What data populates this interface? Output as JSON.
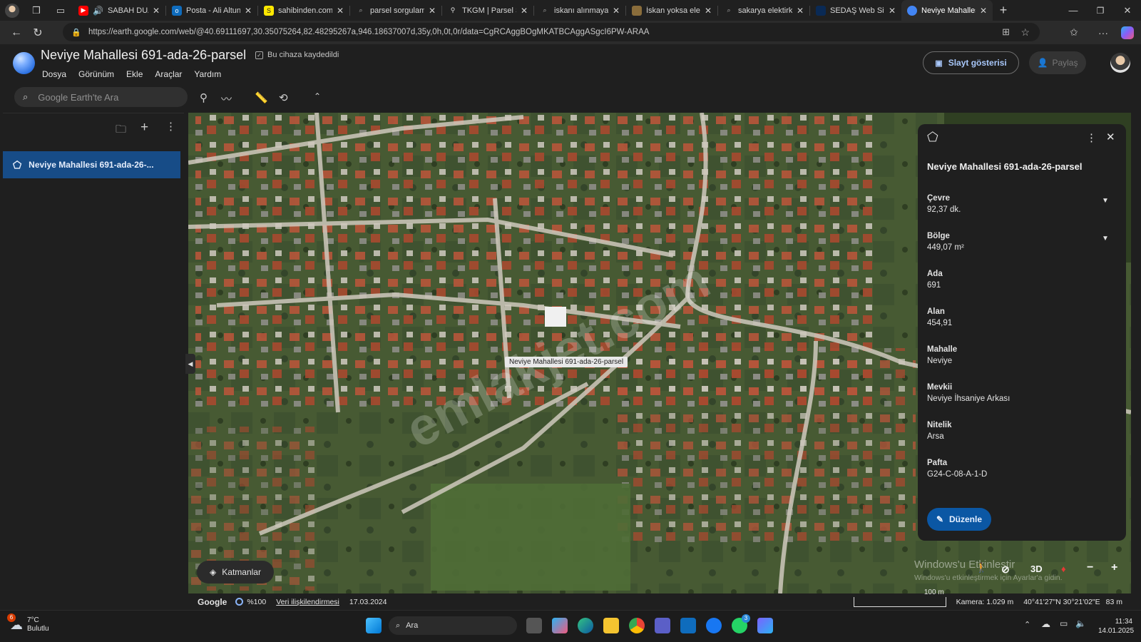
{
  "browser": {
    "tabs": [
      {
        "label": "SABAH DUAS",
        "color": "#ff0000"
      },
      {
        "label": "Posta - Ali Altun -",
        "color": "#0f6cbd"
      },
      {
        "label": "sahibinden.com -",
        "color": "#ffe800"
      },
      {
        "label": "parsel sorgulama",
        "color": "#6b6b6b"
      },
      {
        "label": "TKGM | Parsel Sor",
        "color": "#3a3a3a"
      },
      {
        "label": "iskanı alınmayan y",
        "color": "#6b6b6b"
      },
      {
        "label": "İskan yoksa elekt",
        "color": "#8a6d3b"
      },
      {
        "label": "sakarya elektirk ile",
        "color": "#6b6b6b"
      },
      {
        "label": "SEDAŞ Web Sitesi",
        "color": "#0a2a55"
      },
      {
        "label": "Neviye Mahallesi",
        "color": "#4285f4"
      }
    ],
    "url": "https://earth.google.com/web/@40.69111697,30.35075264,82.48295267a,946.18637007d,35y,0h,0t,0r/data=CgRCAggBOgMKATBCAggASgcI6PW-ARAA"
  },
  "header": {
    "title": "Neviye Mahallesi 691-ada-26-parsel",
    "saved_label": "Bu cihaza kaydedildi",
    "menu": [
      "Dosya",
      "Görünüm",
      "Ekle",
      "Araçlar",
      "Yardım"
    ],
    "slideshow_label": "Slayt gösterisi",
    "share_label": "Paylaş",
    "search_placeholder": "Google Earth'te Ara"
  },
  "sidebar": {
    "item_label": "Neviye Mahallesi 691-ada-26-..."
  },
  "map": {
    "placemark_label": "Neviye Mahallesi 691-ada-26-parsel",
    "watermark": "emlakjet.com",
    "layers_label": "Katmanlar",
    "btn_3d": "3D",
    "windows_line1": "Windows'u Etkinleştir",
    "windows_line2": "Windows'u etkinleştirmek için Ayarlar'a gidin."
  },
  "footer": {
    "brand": "Google",
    "zoom": "%100",
    "data_link": "Veri ilişkilendirmesi",
    "date": "17.03.2024",
    "scale": "100 m",
    "camera": "Kamera: 1.029 m",
    "coords": "40°41'27\"N 30°21'02\"E",
    "elevation": "83 m"
  },
  "panel": {
    "title": "Neviye Mahallesi 691-ada-26-parsel",
    "fields": [
      {
        "key": "Çevre",
        "value": "92,37 dk."
      },
      {
        "key": "Bölge",
        "value": "449,07 m²"
      },
      {
        "key": "Ada",
        "value": "691"
      },
      {
        "key": "Alan",
        "value": "454,91"
      },
      {
        "key": "Mahalle",
        "value": "Neviye"
      },
      {
        "key": "Mevkii",
        "value": "Neviye İhsaniye Arkası"
      },
      {
        "key": "Nitelik",
        "value": "Arsa"
      },
      {
        "key": "Pafta",
        "value": "G24-C-08-A-1-D"
      }
    ],
    "edit_label": "Düzenle"
  },
  "taskbar": {
    "weather_temp": "7°C",
    "weather_desc": "Bulutlu",
    "weather_badge": "6",
    "search_label": "Ara",
    "time": "11:34",
    "date": "14.01.2025",
    "whatsapp_badge": "3"
  }
}
